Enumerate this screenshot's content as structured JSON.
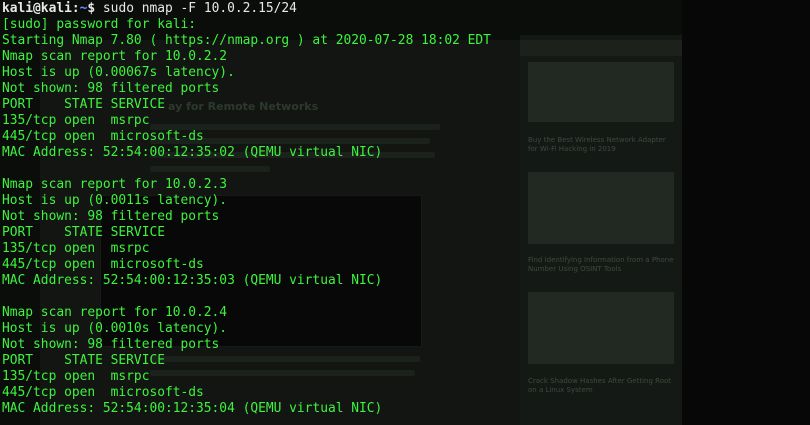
{
  "background_page": {
    "heading": "ay for Remote Networks",
    "sidebar_captions": [
      "Buy the Best Wireless Network Adapter for Wi-Fi Hacking in 2019",
      "Find Identifying Information from a Phone Number Using OSINT Tools",
      "Crack Shadow Hashes After Getting Root on a Linux System"
    ]
  },
  "terminal": {
    "prompt": {
      "user_host": "kali@kali",
      "separator": ":",
      "path": "~",
      "dollar": "$",
      "command": "sudo nmap -F 10.0.2.15/24"
    },
    "lines": [
      "[sudo] password for kali:",
      "Starting Nmap 7.80 ( https://nmap.org ) at 2020-07-28 18:02 EDT",
      "Nmap scan report for 10.0.2.2",
      "Host is up (0.00067s latency).",
      "Not shown: 98 filtered ports",
      "PORT    STATE SERVICE",
      "135/tcp open  msrpc",
      "445/tcp open  microsoft-ds",
      "MAC Address: 52:54:00:12:35:02 (QEMU virtual NIC)",
      "",
      "Nmap scan report for 10.0.2.3",
      "Host is up (0.0011s latency).",
      "Not shown: 98 filtered ports",
      "PORT    STATE SERVICE",
      "135/tcp open  msrpc",
      "445/tcp open  microsoft-ds",
      "MAC Address: 52:54:00:12:35:03 (QEMU virtual NIC)",
      "",
      "Nmap scan report for 10.0.2.4",
      "Host is up (0.0010s latency).",
      "Not shown: 98 filtered ports",
      "PORT    STATE SERVICE",
      "135/tcp open  msrpc",
      "445/tcp open  microsoft-ds",
      "MAC Address: 52:54:00:12:35:04 (QEMU virtual NIC)"
    ]
  },
  "colors": {
    "terminal_text": "#3ef33e",
    "prompt_text": "#e8e8e8",
    "prompt_path": "#5b8fff",
    "background": "#0b0d0b"
  }
}
